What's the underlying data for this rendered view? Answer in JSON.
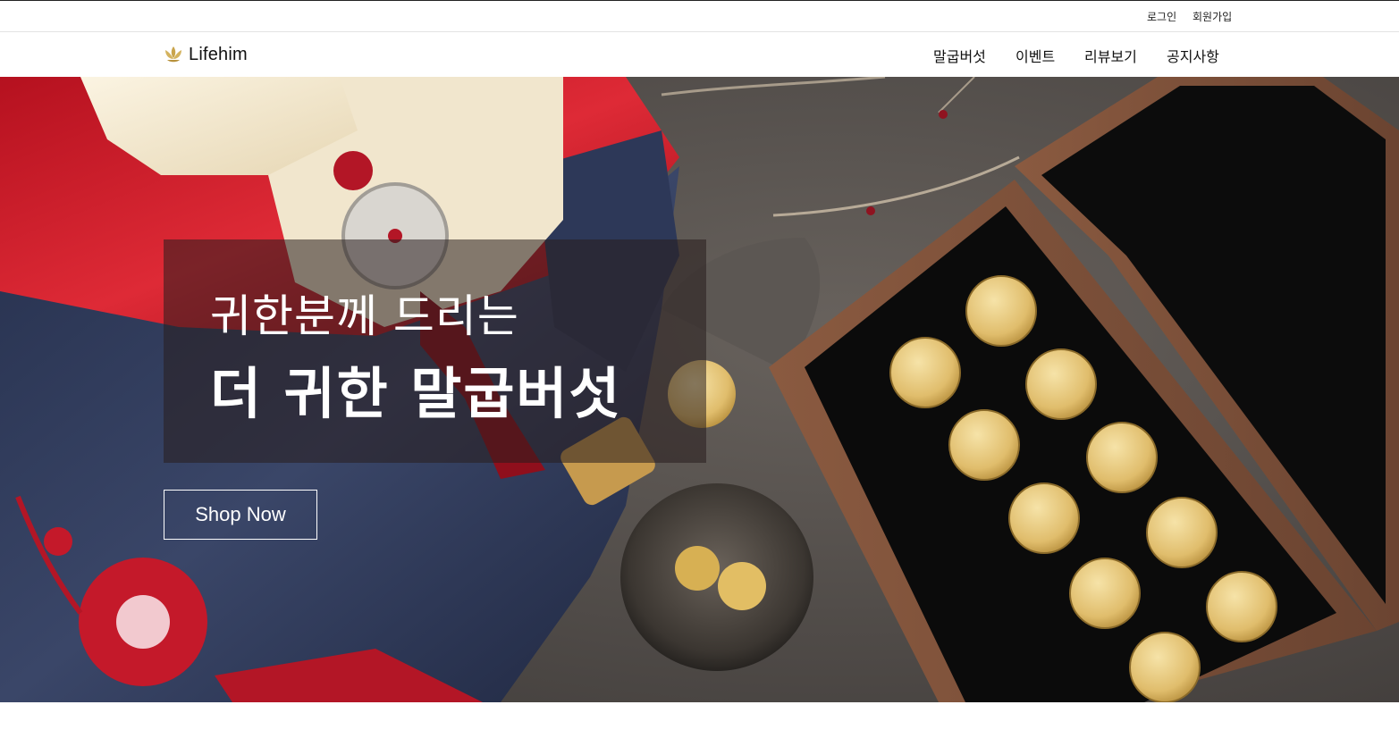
{
  "header": {
    "util_links": {
      "login": "로그인",
      "signup": "회원가입"
    },
    "logo": {
      "text": "Lifehim",
      "icon": "lotus-icon",
      "color": "#c9a44c"
    },
    "nav": [
      {
        "label": "말굽버섯"
      },
      {
        "label": "이벤트"
      },
      {
        "label": "리뷰보기"
      },
      {
        "label": "공지사항"
      }
    ]
  },
  "hero": {
    "headline_line1": "귀한분께 드리는",
    "headline_line2": "더 귀한 말굽버섯",
    "cta_label": "Shop Now",
    "colors": {
      "silk_red": "#c81e2c",
      "silk_navy": "#2a3452",
      "silk_cream": "#f3e9d2",
      "stone_gray": "#58534f",
      "wood_brown": "#7a5039",
      "gold": "#e3c37a"
    }
  }
}
